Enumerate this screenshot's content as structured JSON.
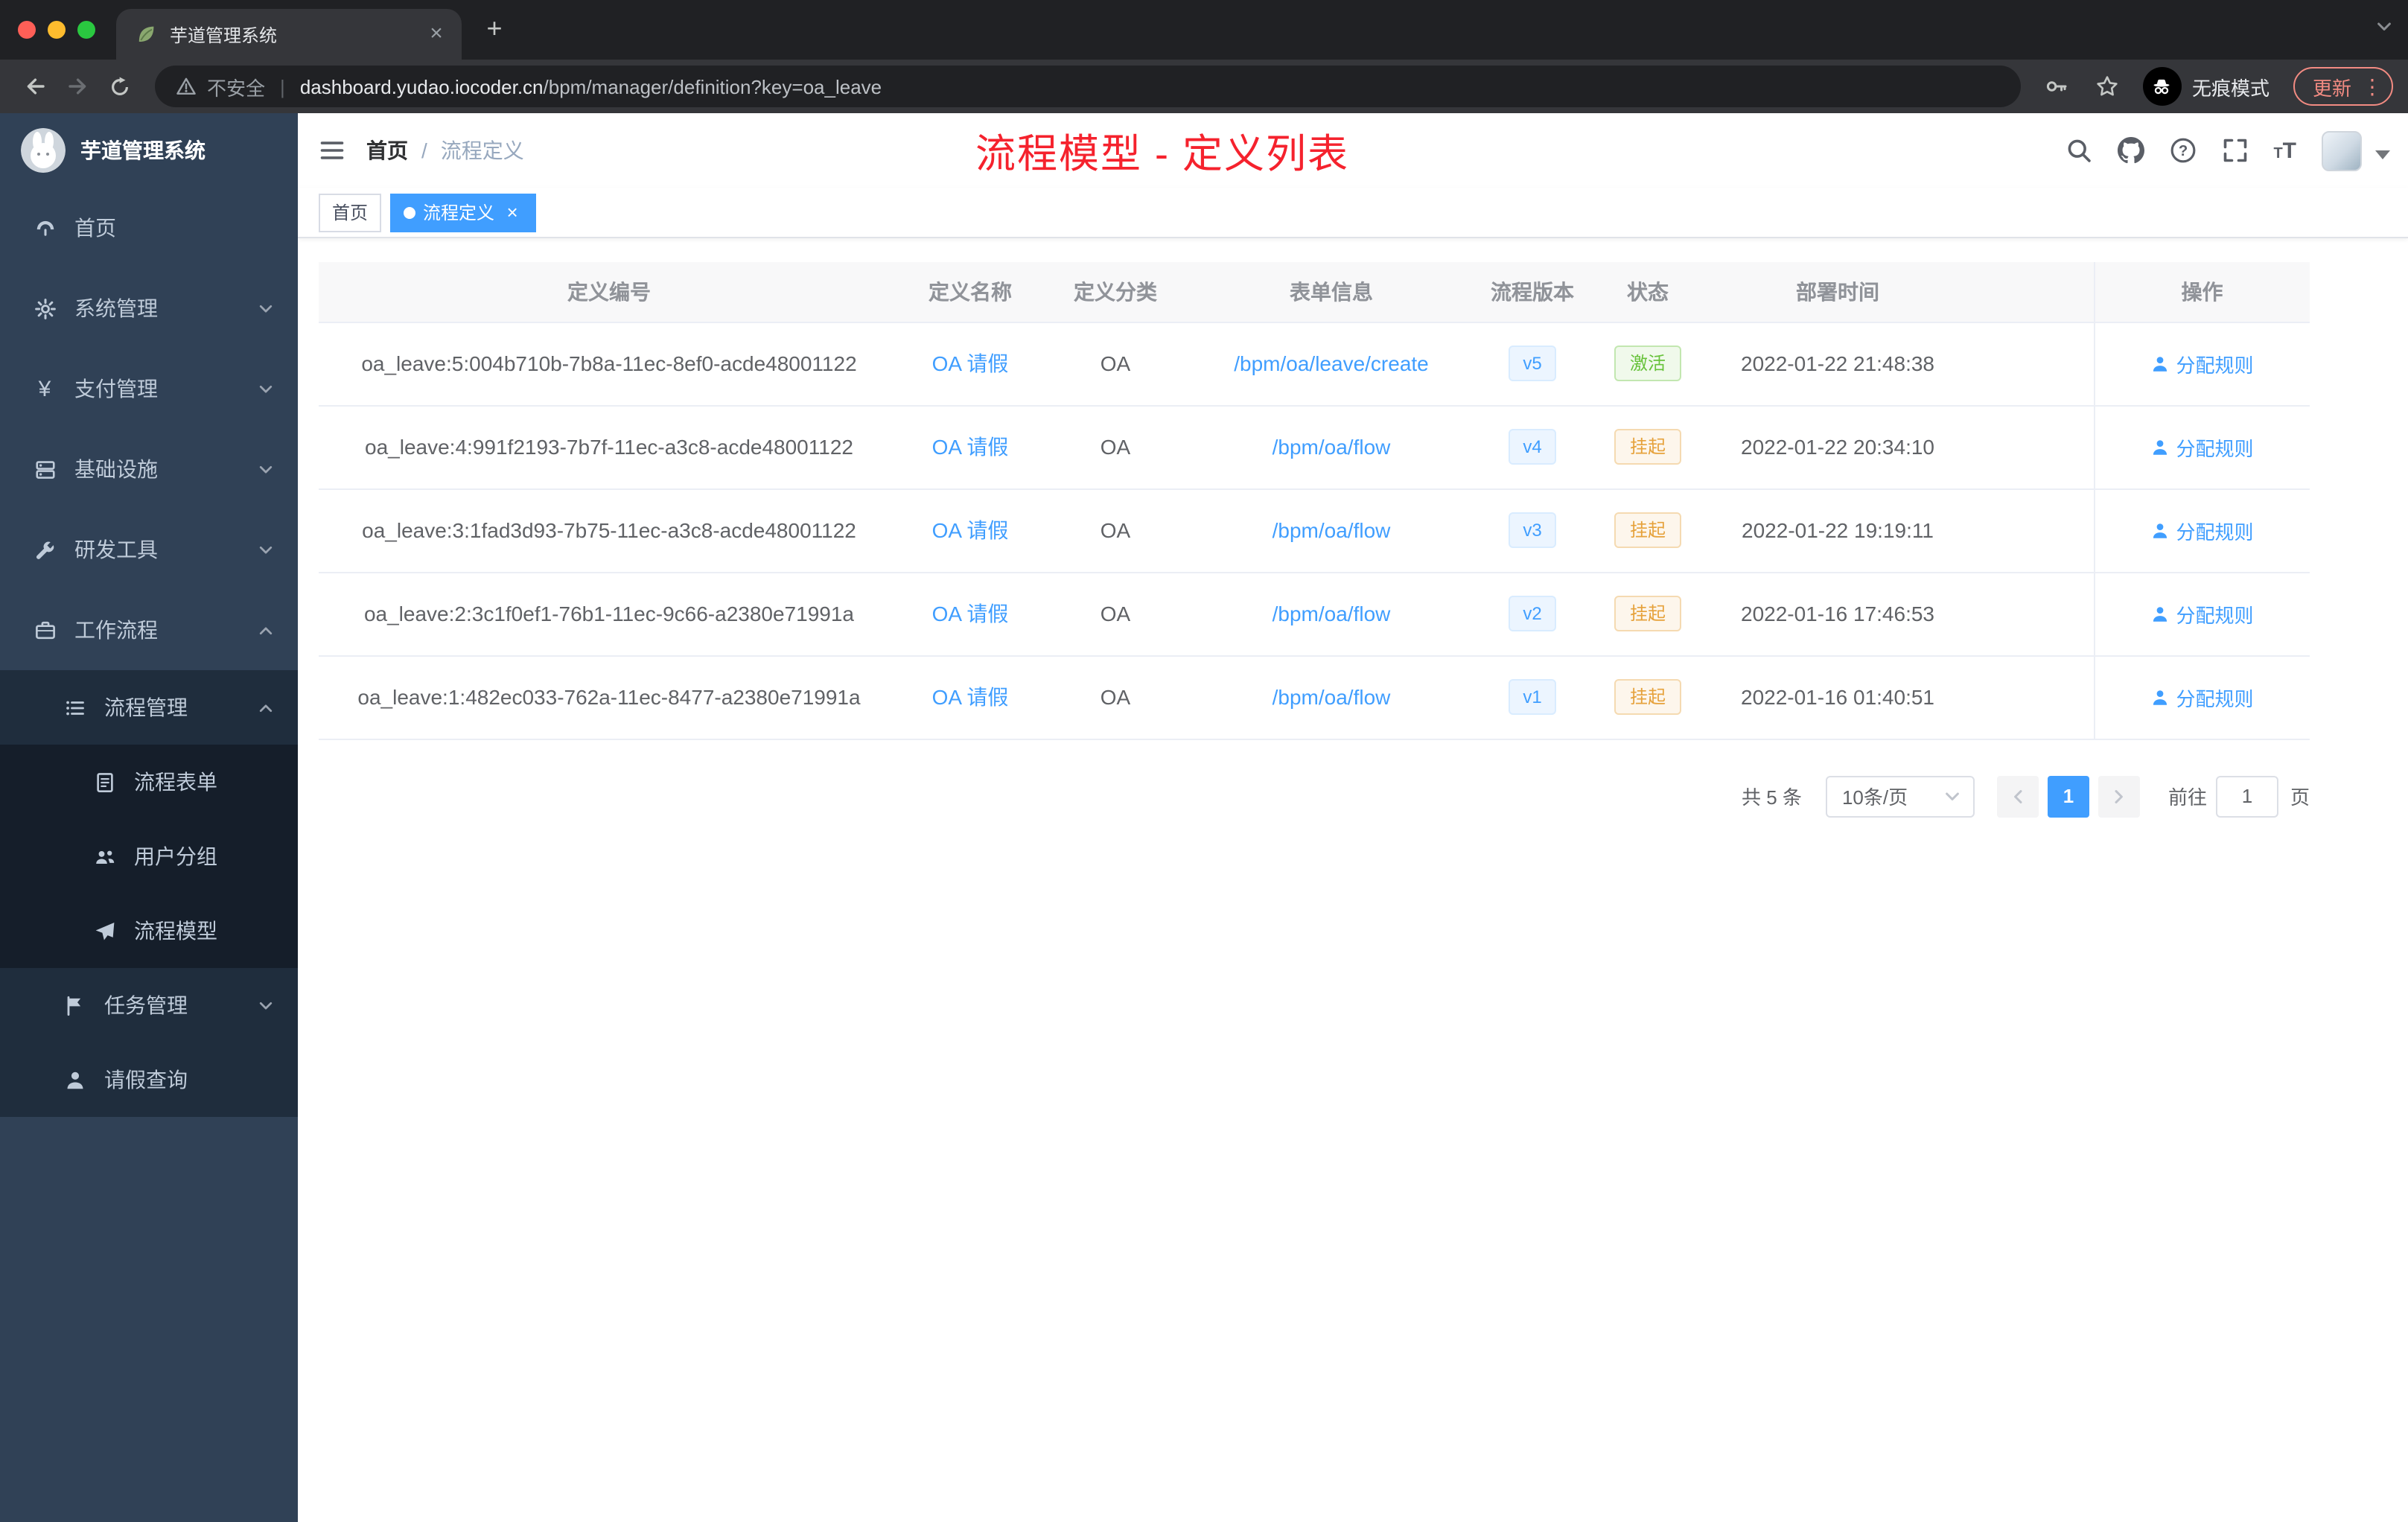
{
  "colors": {
    "accent_blue": "#409eff",
    "annotation_red": "#f5222d",
    "success_green": "#67c23a",
    "warning_orange": "#e6a23c",
    "sidebar_bg": "#304156"
  },
  "browser": {
    "tab_title": "芋道管理系统",
    "security_label": "不安全",
    "url_domain": "dashboard.yudao.iocoder.cn",
    "url_path": "/bpm/manager/definition?key=oa_leave",
    "incognito_label": "无痕模式",
    "update_label": "更新",
    "toolbar_icons": [
      "back-icon",
      "forward-icon",
      "refresh-icon",
      "warning-icon",
      "key-icon",
      "star-icon",
      "incognito-icon",
      "kebab-menu-icon"
    ]
  },
  "sidebar": {
    "logo_title": "芋道管理系统",
    "items": [
      {
        "label": "首页",
        "icon": "dashboard-icon"
      },
      {
        "label": "系统管理",
        "icon": "gear-icon",
        "chevron": "down"
      },
      {
        "label": "支付管理",
        "icon": "yen-icon",
        "chevron": "down"
      },
      {
        "label": "基础设施",
        "icon": "server-icon",
        "chevron": "down"
      },
      {
        "label": "研发工具",
        "icon": "wrench-icon",
        "chevron": "down"
      },
      {
        "label": "工作流程",
        "icon": "briefcase-icon",
        "chevron": "up"
      },
      {
        "label": "流程管理",
        "icon": "list-icon",
        "chevron": "up"
      },
      {
        "label": "流程表单",
        "icon": "document-icon"
      },
      {
        "label": "用户分组",
        "icon": "users-icon"
      },
      {
        "label": "流程模型",
        "icon": "paper-plane-icon"
      },
      {
        "label": "任务管理",
        "icon": "flag-icon",
        "chevron": "down"
      },
      {
        "label": "请假查询",
        "icon": "person-icon"
      }
    ]
  },
  "header": {
    "breadcrumb_home": "首页",
    "breadcrumb_sep": "/",
    "breadcrumb_current": "流程定义",
    "annotation": "流程模型 - 定义列表",
    "right_icons": [
      "search-icon",
      "github-icon",
      "question-icon",
      "fullscreen-icon",
      "font-size-icon",
      "avatar",
      "caret-down-icon"
    ]
  },
  "tags": {
    "items": [
      {
        "label": "首页",
        "active": false
      },
      {
        "label": "流程定义",
        "active": true,
        "closable": true
      }
    ]
  },
  "table": {
    "columns": [
      "定义编号",
      "定义名称",
      "定义分类",
      "表单信息",
      "流程版本",
      "状态",
      "部署时间",
      "操作"
    ],
    "rows": [
      {
        "id": "oa_leave:5:004b710b-7b8a-11ec-8ef0-acde48001122",
        "name": "OA 请假",
        "category": "OA",
        "form": "/bpm/oa/leave/create",
        "version": "v5",
        "status": "激活",
        "status_type": "success",
        "time": "2022-01-22 21:48:38",
        "action": "分配规则"
      },
      {
        "id": "oa_leave:4:991f2193-7b7f-11ec-a3c8-acde48001122",
        "name": "OA 请假",
        "category": "OA",
        "form": "/bpm/oa/flow",
        "version": "v4",
        "status": "挂起",
        "status_type": "warning",
        "time": "2022-01-22 20:34:10",
        "action": "分配规则"
      },
      {
        "id": "oa_leave:3:1fad3d93-7b75-11ec-a3c8-acde48001122",
        "name": "OA 请假",
        "category": "OA",
        "form": "/bpm/oa/flow",
        "version": "v3",
        "status": "挂起",
        "status_type": "warning",
        "time": "2022-01-22 19:19:11",
        "action": "分配规则"
      },
      {
        "id": "oa_leave:2:3c1f0ef1-76b1-11ec-9c66-a2380e71991a",
        "name": "OA 请假",
        "category": "OA",
        "form": "/bpm/oa/flow",
        "version": "v2",
        "status": "挂起",
        "status_type": "warning",
        "time": "2022-01-16 17:46:53",
        "action": "分配规则"
      },
      {
        "id": "oa_leave:1:482ec033-762a-11ec-8477-a2380e71991a",
        "name": "OA 请假",
        "category": "OA",
        "form": "/bpm/oa/flow",
        "version": "v1",
        "status": "挂起",
        "status_type": "warning",
        "time": "2022-01-16 01:40:51",
        "action": "分配规则"
      }
    ]
  },
  "pagination": {
    "total": "共 5 条",
    "page_size": "10条/页",
    "current_page": "1",
    "goto_label": "前往",
    "goto_value": "1",
    "page_unit": "页"
  }
}
